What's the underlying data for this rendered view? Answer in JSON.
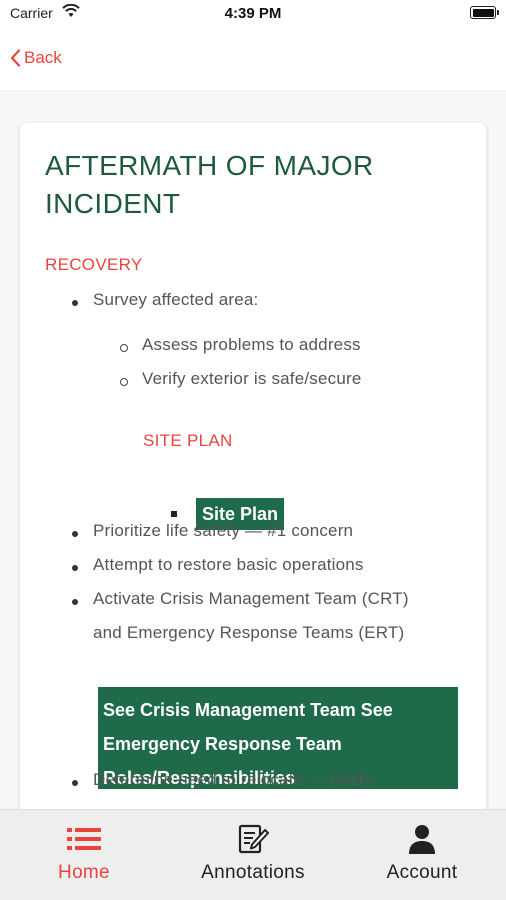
{
  "status_bar": {
    "carrier": "Carrier",
    "time": "4:39 PM"
  },
  "nav": {
    "back_label": "Back"
  },
  "content": {
    "title": "AFTERMATH OF MAJOR INCIDENT",
    "recovery_heading": "RECOVERY",
    "survey_item": "Survey affected area:",
    "sub_items": [
      "Assess problems to address",
      "Verify exterior is safe/secure"
    ],
    "site_plan_heading": "SITE PLAN",
    "site_plan_button": "Site Plan",
    "bullets": [
      "Prioritize life safety — #1 concern",
      "Attempt to restore basic operations",
      "Activate Crisis Management Team (CRT)",
      "and Emergency Response Teams (ERT)"
    ],
    "crisis_button_lines": [
      "See Crisis Management Team See",
      "Emergency Response Team",
      "Roles/Responsibilities"
    ],
    "last_bullet": "Determine need to relocate — notify"
  },
  "tab_bar": {
    "tabs": [
      {
        "label": "Home",
        "icon": "list-icon",
        "active": true
      },
      {
        "label": "Annotations",
        "icon": "annotations-icon",
        "active": false
      },
      {
        "label": "Account",
        "icon": "account-icon",
        "active": false
      }
    ]
  },
  "colors": {
    "accent": "#e8453c",
    "brand_green": "#1f6b49",
    "title_green": "#1f5a3a"
  }
}
